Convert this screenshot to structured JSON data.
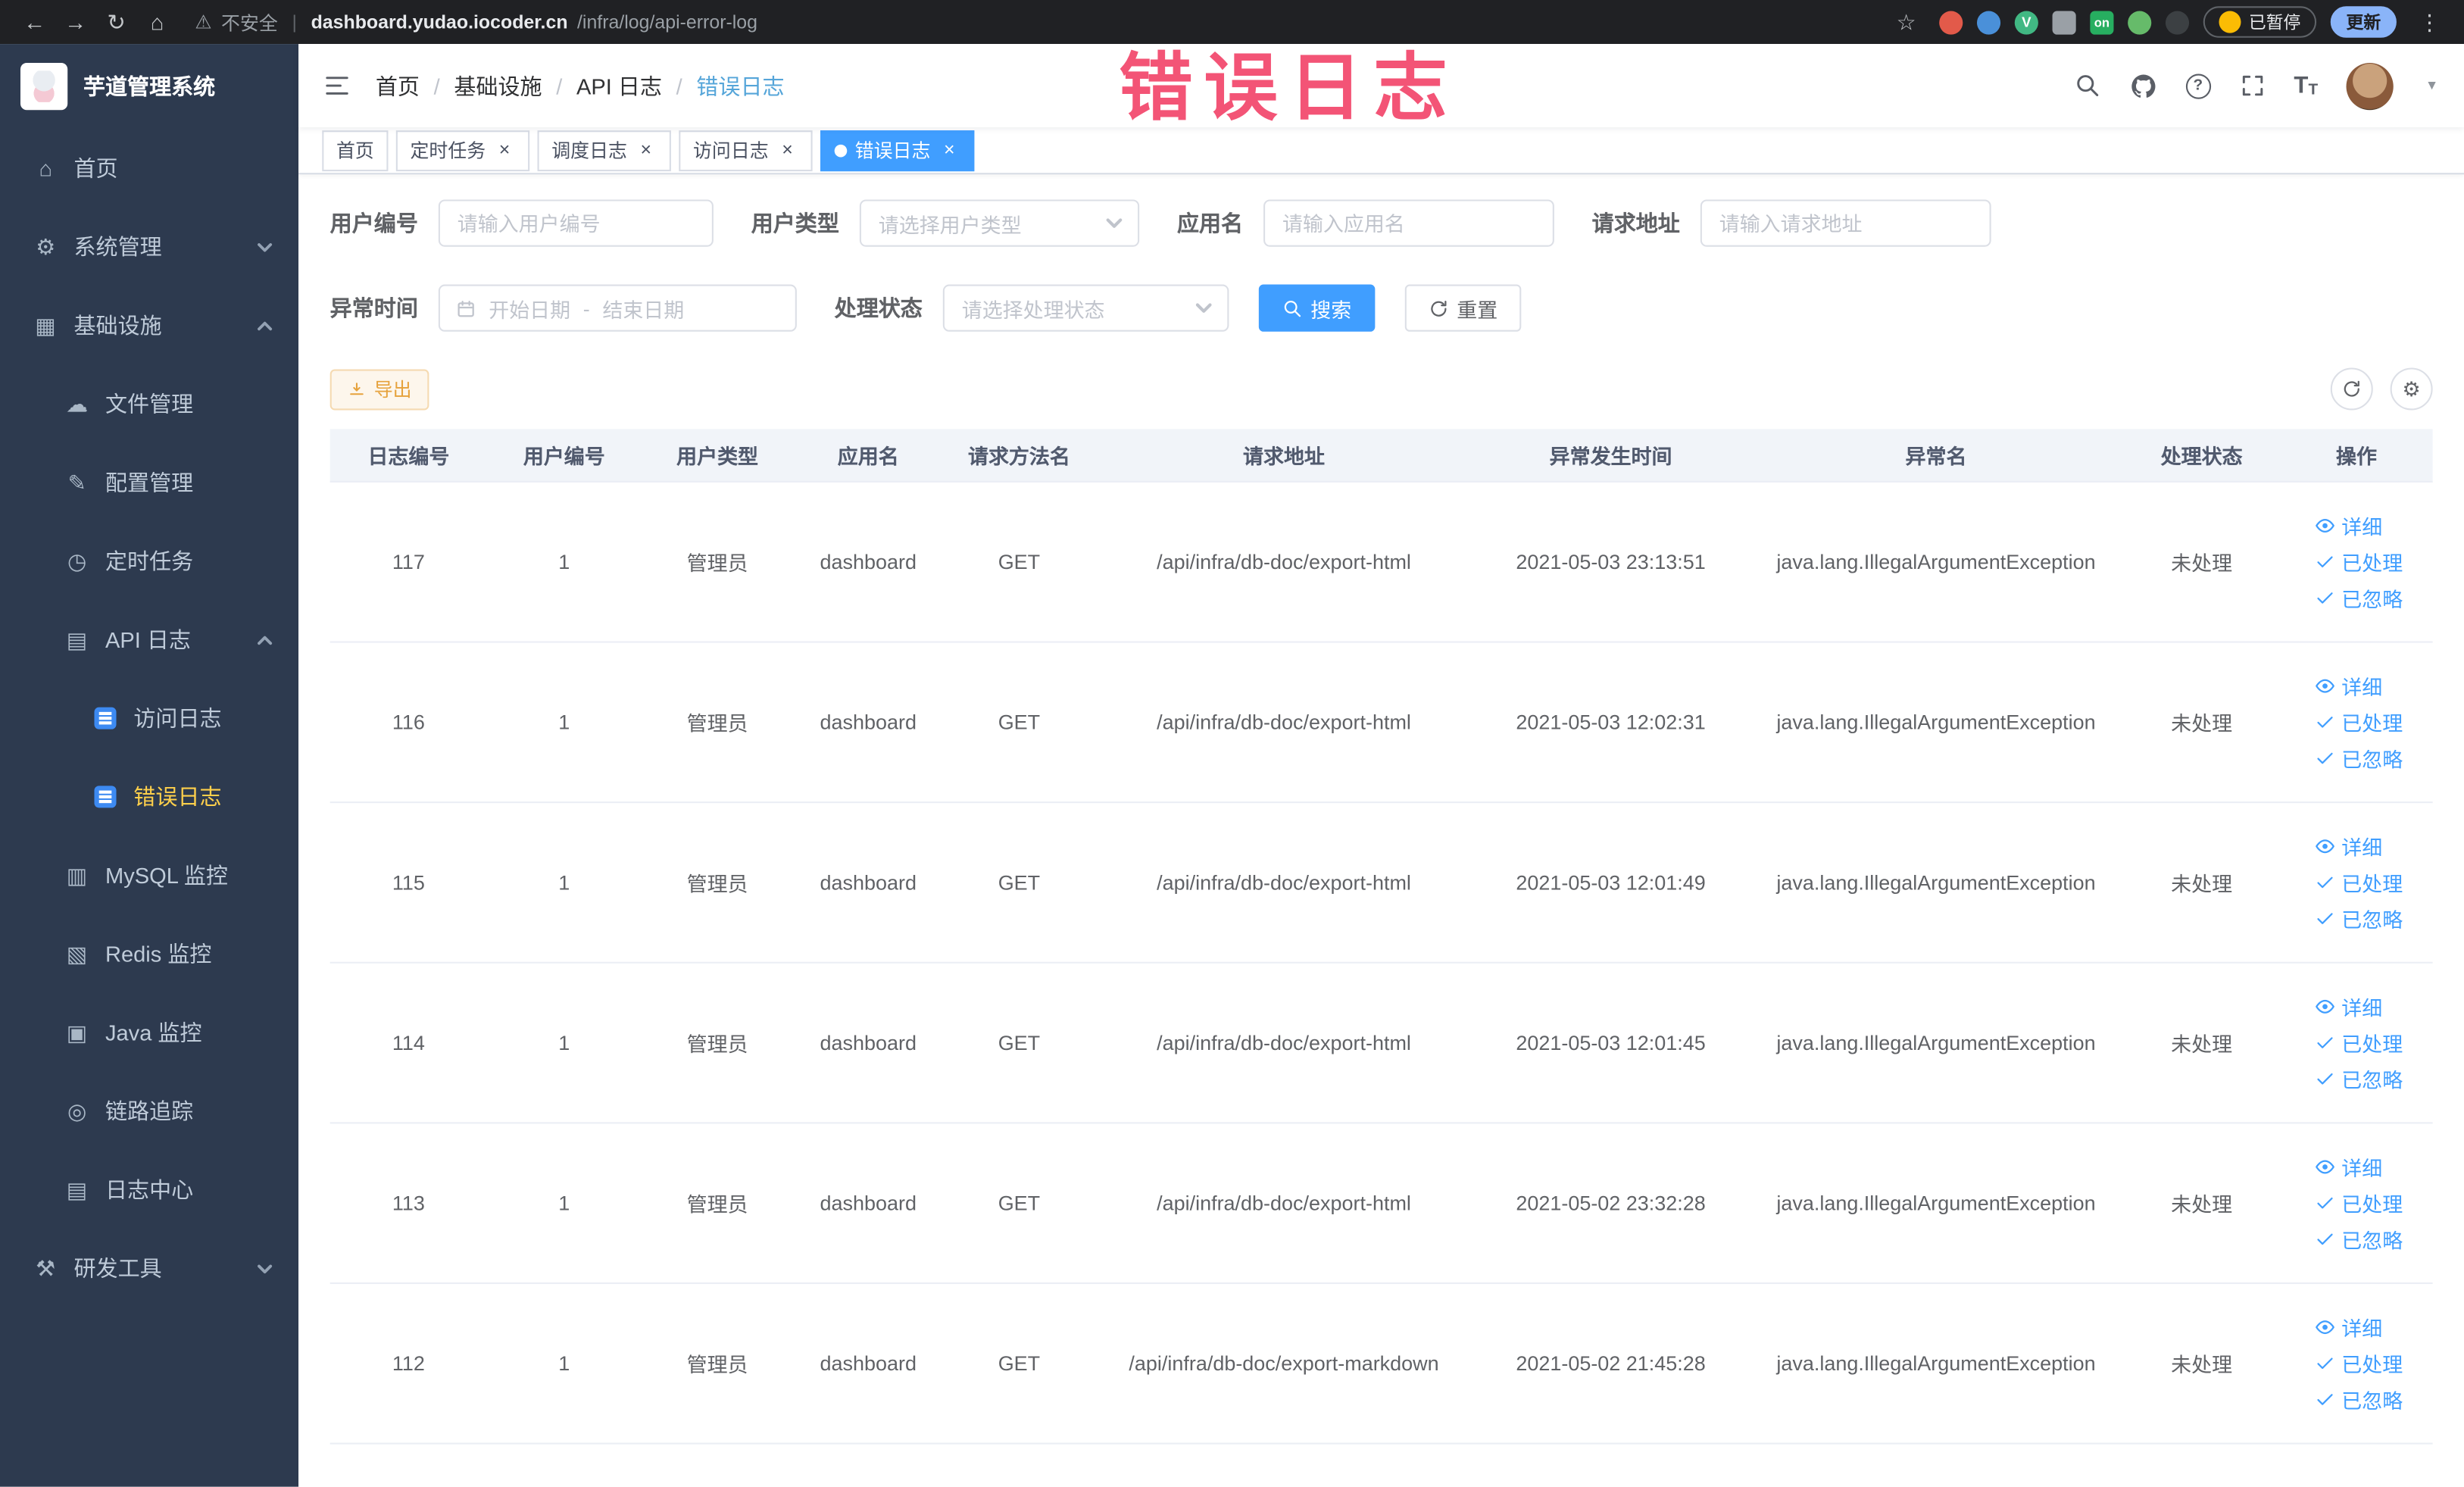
{
  "browser": {
    "insecure_label": "不安全",
    "host": "dashboard.yudao.iocoder.cn",
    "path": "/infra/log/api-error-log",
    "vue_badge": "V",
    "on_badge": "on",
    "paused_label": "已暂停",
    "update_label": "更新"
  },
  "icons": {
    "back": "←",
    "forward": "→",
    "reload": "↻",
    "home": "⌂",
    "warning": "⚠",
    "star": "☆",
    "dots": "⋮",
    "caret": "▾",
    "close": "×",
    "question": "?",
    "tfont": "T",
    "menu_home": "⌂",
    "gear": "⚙",
    "infra": "▦",
    "cloud": "☁",
    "edit": "✎",
    "clock": "◷",
    "doc": "▤",
    "mysql": "▥",
    "redis": "▧",
    "java": "▣",
    "trace": "◎",
    "archive": "▤",
    "tools": "⚒"
  },
  "sidebar": {
    "logo_title": "芋道管理系统",
    "items": [
      {
        "label": "首页"
      },
      {
        "label": "系统管理"
      },
      {
        "label": "基础设施"
      },
      {
        "label": "文件管理"
      },
      {
        "label": "配置管理"
      },
      {
        "label": "定时任务"
      },
      {
        "label": "API 日志"
      },
      {
        "label": "访问日志"
      },
      {
        "label": "错误日志"
      },
      {
        "label": "MySQL 监控"
      },
      {
        "label": "Redis 监控"
      },
      {
        "label": "Java 监控"
      },
      {
        "label": "链路追踪"
      },
      {
        "label": "日志中心"
      },
      {
        "label": "研发工具"
      }
    ]
  },
  "header": {
    "breadcrumb": [
      "首页",
      "基础设施",
      "API 日志",
      "错误日志"
    ]
  },
  "annotation": {
    "text": "错误日志"
  },
  "tabs": [
    {
      "label": "首页"
    },
    {
      "label": "定时任务"
    },
    {
      "label": "调度日志"
    },
    {
      "label": "访问日志"
    },
    {
      "label": "错误日志"
    }
  ],
  "filters": {
    "user_no": {
      "label": "用户编号",
      "placeholder": "请输入用户编号"
    },
    "user_type": {
      "label": "用户类型",
      "placeholder": "请选择用户类型"
    },
    "app_name": {
      "label": "应用名",
      "placeholder": "请输入应用名"
    },
    "request_url": {
      "label": "请求地址",
      "placeholder": "请输入请求地址"
    },
    "time": {
      "label": "异常时间",
      "start_placeholder": "开始日期",
      "separator": "-",
      "end_placeholder": "结束日期"
    },
    "status": {
      "label": "处理状态",
      "placeholder": "请选择处理状态"
    },
    "search_label": "搜索",
    "reset_label": "重置"
  },
  "toolbar": {
    "export_label": "导出"
  },
  "table": {
    "columns": [
      "日志编号",
      "用户编号",
      "用户类型",
      "应用名",
      "请求方法名",
      "请求地址",
      "异常发生时间",
      "异常名",
      "处理状态",
      "操作"
    ],
    "row_actions": [
      "详细",
      "已处理",
      "已忽略"
    ],
    "rows": [
      {
        "id": "117",
        "user_id": "1",
        "user_type": "管理员",
        "app": "dashboard",
        "method": "GET",
        "url": "/api/infra/db-doc/export-html",
        "time": "2021-05-03 23:13:51",
        "exception": "java.lang.IllegalArgumentException",
        "status": "未处理"
      },
      {
        "id": "116",
        "user_id": "1",
        "user_type": "管理员",
        "app": "dashboard",
        "method": "GET",
        "url": "/api/infra/db-doc/export-html",
        "time": "2021-05-03 12:02:31",
        "exception": "java.lang.IllegalArgumentException",
        "status": "未处理"
      },
      {
        "id": "115",
        "user_id": "1",
        "user_type": "管理员",
        "app": "dashboard",
        "method": "GET",
        "url": "/api/infra/db-doc/export-html",
        "time": "2021-05-03 12:01:49",
        "exception": "java.lang.IllegalArgumentException",
        "status": "未处理"
      },
      {
        "id": "114",
        "user_id": "1",
        "user_type": "管理员",
        "app": "dashboard",
        "method": "GET",
        "url": "/api/infra/db-doc/export-html",
        "time": "2021-05-03 12:01:45",
        "exception": "java.lang.IllegalArgumentException",
        "status": "未处理"
      },
      {
        "id": "113",
        "user_id": "1",
        "user_type": "管理员",
        "app": "dashboard",
        "method": "GET",
        "url": "/api/infra/db-doc/export-html",
        "time": "2021-05-02 23:32:28",
        "exception": "java.lang.IllegalArgumentException",
        "status": "未处理"
      },
      {
        "id": "112",
        "user_id": "1",
        "user_type": "管理员",
        "app": "dashboard",
        "method": "GET",
        "url": "/api/infra/db-doc/export-markdown",
        "time": "2021-05-02 21:45:28",
        "exception": "java.lang.IllegalArgumentException",
        "status": "未处理"
      }
    ]
  },
  "colors": {
    "accent": "#409EFF",
    "sidebar_bg": "#2d3a4f",
    "active_menu": "#ffd04b",
    "annotation": "#f2466b",
    "warning_text": "#e6a23c"
  }
}
